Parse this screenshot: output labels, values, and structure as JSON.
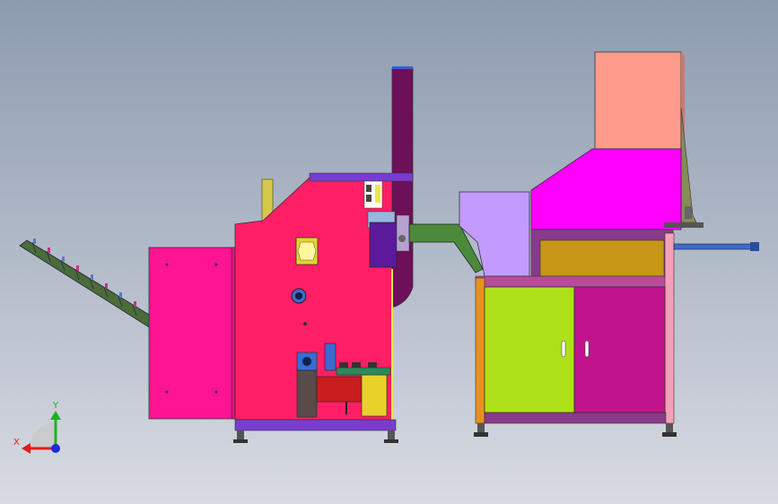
{
  "viewport": {
    "background_top": "#8d9bb0",
    "background_bottom": "#d8dbe2"
  },
  "triad": {
    "x_label": "X",
    "y_label": "Y",
    "x_color": "#e21b1b",
    "y_color": "#1bb21b",
    "z_color": "#1b2be2"
  },
  "colors": {
    "main_body": "#ff1f66",
    "side_panel": "#ff1493",
    "chute": "#6e0f5a",
    "conveyor": "#4a6b3a",
    "hopper_lower": "#ff00ff",
    "hopper_upper": "#ff9b8c",
    "feeder_box": "#c39bff",
    "drawer": "#c89616",
    "cabinet_left": "#aee01a",
    "cabinet_right": "#c0148c",
    "base_bar": "#7a3ccf"
  }
}
